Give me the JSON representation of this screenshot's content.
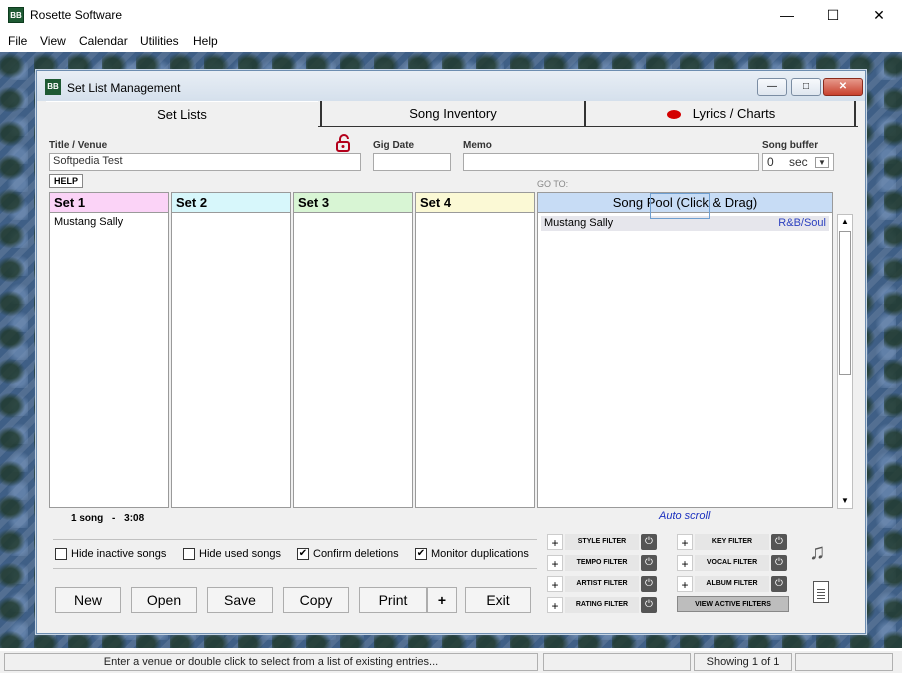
{
  "window": {
    "title": "Rosette Software",
    "icon_text": "BB"
  },
  "menu": [
    "File",
    "View",
    "Calendar",
    "Utilities",
    "Help"
  ],
  "dialog": {
    "title": "Set List Management",
    "icon_text": "BB",
    "tabs": [
      "Set Lists",
      "Song Inventory",
      "Lyrics / Charts"
    ]
  },
  "form": {
    "title_label": "Title / Venue",
    "title_value": "Softpedia Test",
    "gig_label": "Gig Date",
    "gig_value": "",
    "memo_label": "Memo",
    "memo_value": "",
    "buffer_label": "Song buffer",
    "buffer_value": "0",
    "buffer_unit": "sec"
  },
  "help_label": "HELP",
  "goto_label": "GO TO:",
  "sets": [
    {
      "name": "Set 1",
      "color": "#fbd3f7",
      "songs": [
        "Mustang Sally"
      ]
    },
    {
      "name": "Set 2",
      "color": "#d7f7fb",
      "songs": []
    },
    {
      "name": "Set 3",
      "color": "#d8f5d4",
      "songs": []
    },
    {
      "name": "Set 4",
      "color": "#fbf9d5",
      "songs": []
    }
  ],
  "pool": {
    "header": "Song Pool (Click & Drag)",
    "items": [
      {
        "title": "Mustang Sally",
        "genre": "R&B/Soul"
      }
    ]
  },
  "summary": {
    "count": "1 song",
    "sep": "-",
    "duration": "3:08"
  },
  "autoscroll": "Auto scroll",
  "options": [
    {
      "label": "Hide inactive songs",
      "checked": false
    },
    {
      "label": "Hide used songs",
      "checked": false
    },
    {
      "label": "Confirm deletions",
      "checked": true
    },
    {
      "label": "Monitor duplications",
      "checked": true
    }
  ],
  "buttons": {
    "new": "New",
    "open": "Open",
    "save": "Save",
    "copy": "Copy",
    "print": "Print",
    "plus": "+",
    "exit": "Exit"
  },
  "filters": {
    "style": "STYLE FILTER",
    "tempo": "TEMPO FILTER",
    "artist": "ARTIST FILTER",
    "rating": "RATING FILTER",
    "key": "KEY FILTER",
    "vocal": "VOCAL FILTER",
    "album": "ALBUM FILTER",
    "view": "VIEW ACTIVE FILTERS"
  },
  "status": {
    "message": "Enter a venue or double click to select from a list of existing entries...",
    "showing": "Showing 1 of 1"
  }
}
